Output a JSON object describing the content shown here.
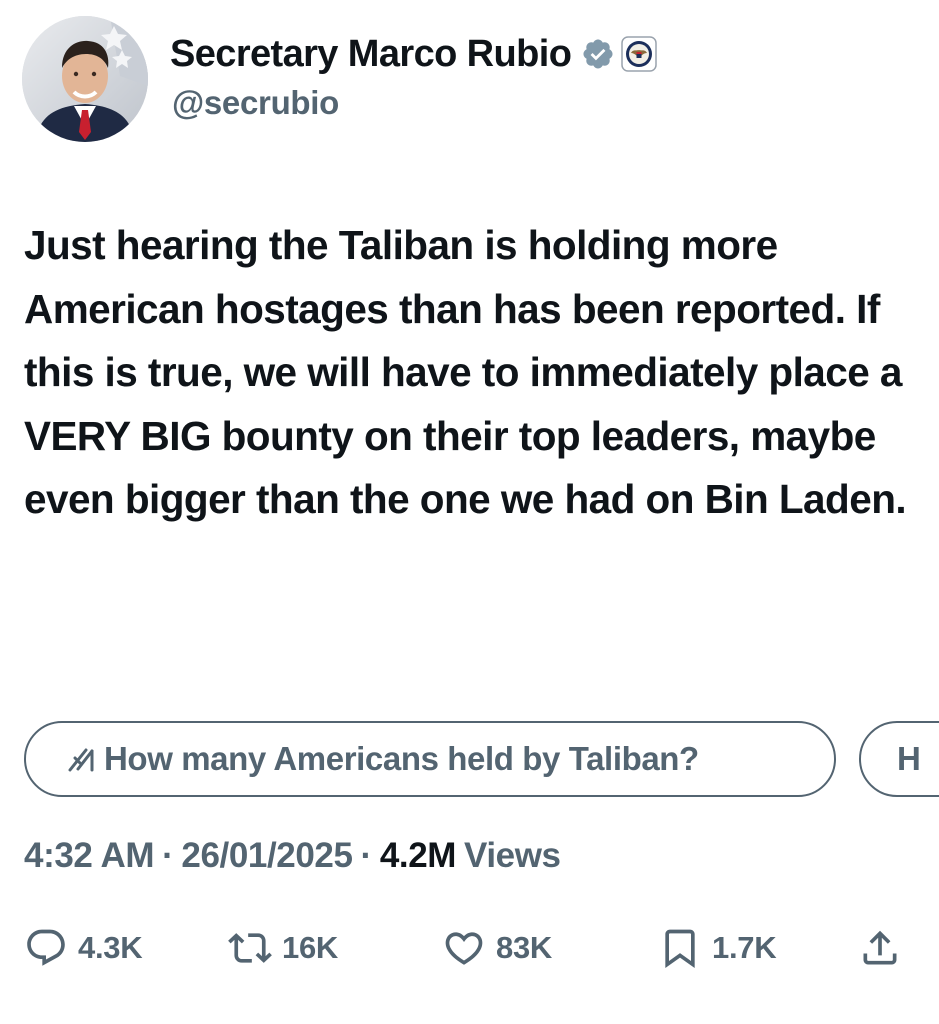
{
  "author": {
    "display_name": "Secretary Marco Rubio",
    "handle": "@secrubio",
    "verified_icon": "verified-badge-icon",
    "affiliation_icon": "department-seal-icon",
    "avatar": "profile-photo"
  },
  "tweet": {
    "text": "Just hearing the Taliban is holding more American hostages than has been reported. If this is true, we will have to immediately place a VERY BIG bounty on their top leaders, maybe even bigger than the one we had on Bin Laden."
  },
  "suggestions": [
    {
      "label": "How many Americans held by Taliban?",
      "icon": "grok-icon"
    },
    {
      "label": "H"
    }
  ],
  "meta": {
    "time": "4:32 AM",
    "date": "26/01/2025",
    "views_count": "4.2M",
    "views_label": "Views",
    "separator": "·"
  },
  "actions": {
    "reply": {
      "count": "4.3K",
      "icon": "reply-icon"
    },
    "repost": {
      "count": "16K",
      "icon": "repost-icon"
    },
    "like": {
      "count": "83K",
      "icon": "heart-icon"
    },
    "bookmark": {
      "count": "1.7K",
      "icon": "bookmark-icon"
    },
    "share": {
      "icon": "share-icon"
    }
  },
  "colors": {
    "text": "#0f1419",
    "secondary": "#536471",
    "verified_badge": "#829aab",
    "background": "#ffffff"
  }
}
